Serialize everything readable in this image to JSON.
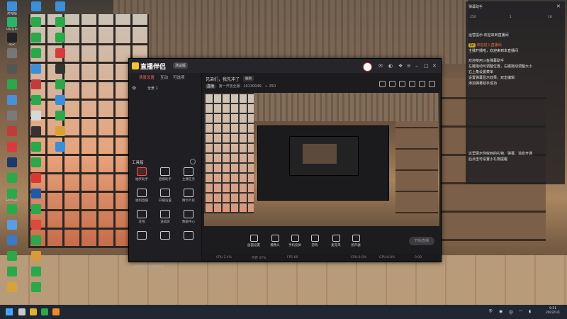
{
  "desktop": {
    "icons": [
      {
        "label": "此电脑",
        "color": "#3b8fd8"
      },
      {
        "label": "QQ音乐",
        "color": "#29b36b"
      },
      {
        "label": "epic",
        "color": "#222"
      },
      {
        "label": "",
        "color": "#777"
      },
      {
        "label": "",
        "color": "#555"
      },
      {
        "label": "",
        "color": "#2aa84a"
      },
      {
        "label": "",
        "color": "#4a8fd8"
      },
      {
        "label": "",
        "color": "#7a7a7a"
      },
      {
        "label": "",
        "color": "#c23b3b"
      },
      {
        "label": "",
        "color": "#d83b3b"
      },
      {
        "label": "",
        "color": "#1a3a6b"
      },
      {
        "label": "",
        "color": "#2aa84a"
      },
      {
        "label": "Backup",
        "color": "#2aa84a"
      },
      {
        "label": "",
        "color": "#2aa84a"
      },
      {
        "label": "",
        "color": "#5a9de0"
      },
      {
        "label": "",
        "color": "#3b7ac9"
      },
      {
        "label": "",
        "color": "#2aa84a"
      },
      {
        "label": "",
        "color": "#2aa84a"
      },
      {
        "label": "",
        "color": "#d8a23b"
      },
      {
        "label": "",
        "color": "#3b8fd8"
      },
      {
        "label": "",
        "color": "#2aa84a"
      },
      {
        "label": "",
        "color": "#2aa84a"
      },
      {
        "label": "",
        "color": "#2aa84a"
      },
      {
        "label": "",
        "color": "#3b8fd8"
      },
      {
        "label": "",
        "color": "#c23b3b"
      },
      {
        "label": "",
        "color": "#2aa84a"
      },
      {
        "label": "",
        "color": "#d8d8d8"
      },
      {
        "label": "",
        "color": "#333"
      },
      {
        "label": "",
        "color": "#2aa84a"
      },
      {
        "label": "",
        "color": "#2aa84a"
      },
      {
        "label": "",
        "color": "#d8372f"
      },
      {
        "label": "",
        "color": "#1e5aa8"
      },
      {
        "label": "",
        "color": "#2aa84a"
      },
      {
        "label": "",
        "color": "#d84a3b"
      },
      {
        "label": "",
        "color": "#2aa84a"
      },
      {
        "label": "",
        "color": "#d89a3b"
      },
      {
        "label": "",
        "color": "#2aa84a"
      },
      {
        "label": "",
        "color": "#2aa84a"
      },
      {
        "label": "",
        "color": "#3b8fd8"
      },
      {
        "label": "",
        "color": "#2aa84a"
      },
      {
        "label": "",
        "color": "#2aa84a"
      },
      {
        "label": "",
        "color": "#d83b3b"
      },
      {
        "label": "",
        "color": "#333"
      },
      {
        "label": "",
        "color": "#2aa84a"
      },
      {
        "label": "",
        "color": "#3b8fd8"
      },
      {
        "label": "",
        "color": "#2aa84a"
      },
      {
        "label": "",
        "color": "#d8a23b"
      },
      {
        "label": "",
        "color": "#3b8fd8"
      }
    ]
  },
  "window": {
    "app_name": "直播伴侣",
    "beta_label": "测试版",
    "left_tabs": [
      "场景设置",
      "互动",
      "可选项"
    ],
    "scene_label": "全景 1",
    "tools_header": "工具箱",
    "tools": [
      {
        "label": "抽奖助手",
        "hot": true
      },
      {
        "label": "直播助手",
        "hot": false
      },
      {
        "label": "主播任务",
        "hot": false
      },
      {
        "label": "福利直播",
        "hot": false
      },
      {
        "label": "开播设置",
        "hot": false
      },
      {
        "label": "精华片段",
        "hot": false
      },
      {
        "label": "连线",
        "hot": false
      },
      {
        "label": "送福袋",
        "hot": false
      },
      {
        "label": "数据中心",
        "hot": false
      },
      {
        "label": "",
        "hot": false
      },
      {
        "label": "",
        "hot": false
      },
      {
        "label": "",
        "hot": false
      }
    ],
    "promo_text": "斗鱼直播伴侣使用教程",
    "room_title": "兄弟们，我先冲了",
    "edit_tag": "编辑",
    "meta_badge": "直播",
    "meta_text": "第一开放全服 · 10130049",
    "viewer_count": "250",
    "controls": [
      "画面设置",
      "摄像头",
      "手机投屏",
      "游戏",
      "麦克风",
      "扬声器"
    ],
    "live_button": "开始直播",
    "status": [
      "CPU 2.4%",
      "内存 37%",
      "FPS 60",
      "",
      "CPU:0.0%",
      "GPU:0.0%",
      "0.00"
    ]
  },
  "chat": {
    "title": "弹幕助手",
    "close_icon": "✕",
    "stats": [
      "250",
      "1",
      "16"
    ],
    "lines": [
      {
        "text": "运营提示:欢迎来到直播间",
        "red": false,
        "tag": ""
      },
      {
        "text": "欢迎进入直播间",
        "red": true,
        "tag": "LV"
      },
      {
        "text": "主播开播啦，欢迎来到本直播间",
        "red": false,
        "tag": ""
      },
      {
        "text": "欢迎使用斗鱼弹幕助手",
        "red": false,
        "tag": ""
      },
      {
        "text": "左键拖动可调整位置，右键拖动调整大小",
        "red": false,
        "tag": ""
      },
      {
        "text": "右上角设置菜单",
        "red": false,
        "tag": ""
      },
      {
        "text": "设置弹幕显示效果，双击编辑",
        "red": false,
        "tag": ""
      },
      {
        "text": "添加弹幕助手成功",
        "red": false,
        "tag": ""
      },
      {
        "text": "这里展示你收到的礼物、弹幕、消息开通",
        "red": false,
        "tag": ""
      },
      {
        "text": "后点击可设置小礼物提醒",
        "red": false,
        "tag": ""
      }
    ]
  },
  "taskbar": {
    "tray_text": "中",
    "time": "9:51",
    "date": "2022/1/1"
  }
}
